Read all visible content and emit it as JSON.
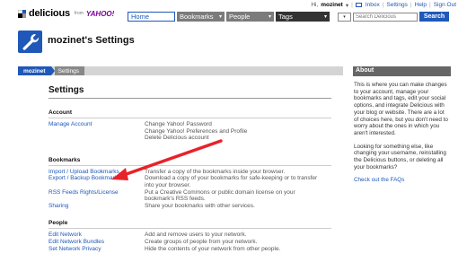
{
  "userbar": {
    "greeting": "Hi,",
    "username": "mozinet",
    "dropdown": "▾",
    "inbox": "Inbox",
    "settings": "Settings",
    "help": "Help",
    "signout": "Sign Out"
  },
  "logo": {
    "name": "delicious",
    "from": "from",
    "yahoo": "YAHOO!"
  },
  "nav": {
    "home": "Home",
    "bookmarks": "Bookmarks",
    "people": "People",
    "tags": "Tags",
    "caret": "▾"
  },
  "search": {
    "scope": "▾",
    "placeholder": "Search Delicious",
    "button": "Search"
  },
  "page": {
    "title": "mozinet's Settings"
  },
  "breadcrumb": {
    "user": "mozinet",
    "current": "Settings"
  },
  "main": {
    "heading": "Settings",
    "sections": [
      {
        "title": "Account",
        "rows": [
          {
            "link": "Manage Account",
            "desc": "Change Yahoo! Password"
          },
          {
            "link": "",
            "desc": "Change Yahoo! Preferences and Profile"
          },
          {
            "link": "",
            "desc": "Delete Delicious account"
          }
        ]
      },
      {
        "title": "Bookmarks",
        "rows": [
          {
            "link": "Import / Upload Bookmarks",
            "desc": "Transfer a copy of the bookmarks inside your browser."
          },
          {
            "link": "Export / Backup Bookmarks",
            "desc": "Download a copy of your bookmarks for safe-keeping or to transfer"
          },
          {
            "link": "",
            "desc": "into your browser."
          },
          {
            "link": "RSS Feeds Rights/License",
            "desc": "Put a Creative Commons or public domain license on your"
          },
          {
            "link": "",
            "desc": "bookmark's RSS feeds."
          },
          {
            "link": "Sharing",
            "desc": "Share your bookmarks with other services."
          }
        ]
      },
      {
        "title": "People",
        "rows": [
          {
            "link": "Edit Network",
            "desc": "Add and remove users to your network."
          },
          {
            "link": "Edit Network Bundles",
            "desc": "Create groups of people from your network."
          },
          {
            "link": "Set Network Privacy",
            "desc": "Hide the contents of your network from other people."
          }
        ]
      }
    ]
  },
  "sidebar": {
    "heading": "About",
    "para1": "This is where you can make changes to your account, manage your bookmarks and tags, edit your social options, and integrate Delicious with your blog or website. There are a lot of choices here, but you don't need to worry about the ones in which you aren't interested.",
    "para2": "Looking for something else, like changing your username, reinstalling the Delicious buttons, or deleting all your bookmarks?",
    "faq_link": "Check out the FAQs"
  },
  "colors": {
    "brand_blue": "#1f58b8",
    "annotation_red": "#e8222a"
  }
}
